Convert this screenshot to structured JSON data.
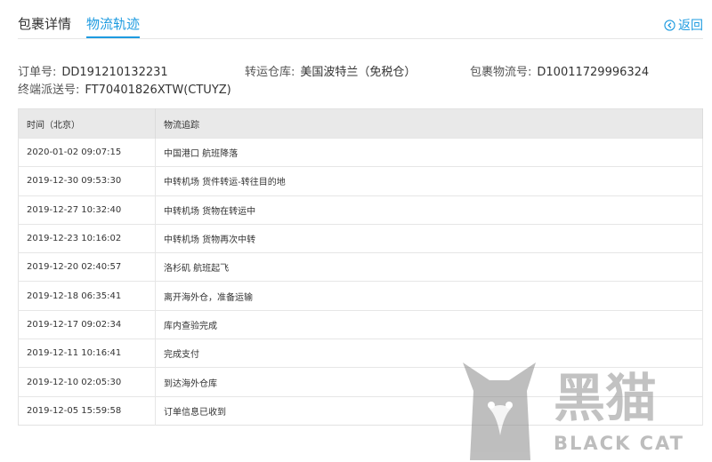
{
  "tabs": [
    {
      "label": "包裹详情",
      "active": false
    },
    {
      "label": "物流轨迹",
      "active": true
    }
  ],
  "back_label": "返回",
  "info": {
    "order_label": "订单号:",
    "order_value": "DD191210132231",
    "warehouse_label": "转运仓库:",
    "warehouse_value": "美国波特兰（免税仓）",
    "package_label": "包裹物流号:",
    "package_value": "D10011729996324",
    "terminal_label": "终端派送号:",
    "terminal_value": "FT70401826XTW(CTUYZ)"
  },
  "table": {
    "headers": [
      "时间（北京）",
      "物流追踪"
    ],
    "rows": [
      [
        "2020-01-02 09:07:15",
        "中国港口 航班降落"
      ],
      [
        "2019-12-30 09:53:30",
        "中转机场 货件转运-转往目的地"
      ],
      [
        "2019-12-27 10:32:40",
        "中转机场 货物在转运中"
      ],
      [
        "2019-12-23 10:16:02",
        "中转机场 货物再次中转"
      ],
      [
        "2019-12-20 02:40:57",
        "洛杉矶 航班起飞"
      ],
      [
        "2019-12-18 06:35:41",
        "离开海外仓，准备运输"
      ],
      [
        "2019-12-17 09:02:34",
        "库内查验完成"
      ],
      [
        "2019-12-11 10:16:41",
        "完成支付"
      ],
      [
        "2019-12-10 02:05:30",
        "到达海外仓库"
      ],
      [
        "2019-12-05 15:59:58",
        "订单信息已收到"
      ]
    ]
  },
  "watermark": {
    "cn": "黑猫",
    "en": "BLACK CAT"
  },
  "colors": {
    "accent": "#1e9be0",
    "header_bg": "#e9e9e9",
    "watermark": "#9a9a9a"
  }
}
